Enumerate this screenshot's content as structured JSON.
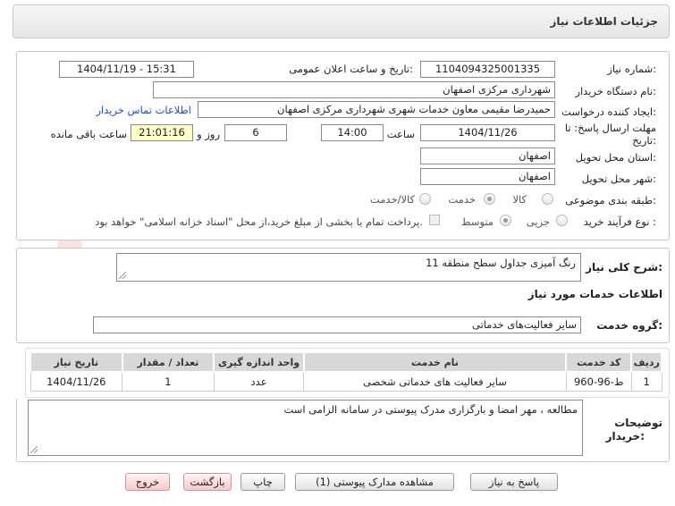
{
  "header": {
    "title": "جزئیات اطلاعات نیاز"
  },
  "form": {
    "need_number_label": "شماره نیاز:",
    "need_number_value": "1104094325001335",
    "announce_label": "تاریخ و ساعت اعلان عمومی:",
    "announce_value": "1404/11/19 - 15:31",
    "buyer_org_label": "نام دستگاه خریدار:",
    "buyer_org_value": "شهرداری مرکزی اصفهان",
    "creator_label": "ایجاد کننده درخواست:",
    "creator_value": "حمیدرضا مقیمی معاون خدمات شهری شهرداری مرکزی اصفهان",
    "contact_link": "اطلاعات تماس خریدار",
    "deadline_label_1": "مهلت ارسال پاسخ: تا",
    "deadline_label_2": "تاریخ:",
    "deadline_date": "1404/11/26",
    "time_label": "ساعت",
    "deadline_time": "14:00",
    "days_value": "6",
    "days_label": "روز و",
    "remaining_time": "21:01:16",
    "remaining_label": "ساعت باقی مانده",
    "province_label": "استان محل تحویل:",
    "province_value": "اصفهان",
    "city_label": "شهر محل تحویل:",
    "city_value": "اصفهان",
    "category_label": "طبقه بندی موضوعی:",
    "category_options": [
      "کالا",
      "خدمت",
      "کالا/خدمت"
    ],
    "category_selected": "خدمت",
    "process_label": "نوع فرآیند خرید :",
    "process_options": [
      "جزیی",
      "متوسط"
    ],
    "process_selected": "متوسط",
    "payment_note": "پرداخت تمام یا بخشی از مبلغ خرید،از محل \"اسناد خزانه اسلامی\" خواهد بود."
  },
  "summary": {
    "label": "شرح کلی نیاز:",
    "value": "رنگ آمیزی جداول سطح منطقه 11"
  },
  "services": {
    "section_title": "اطلاعات خدمات مورد نیاز",
    "group_label": "گروه خدمت:",
    "group_value": "سایر فعالیت‌های خدماتی",
    "columns": [
      "ردیف",
      "کد خدمت",
      "نام خدمت",
      "واحد اندازه گیری",
      "تعداد / مقدار",
      "تاریخ نیاز"
    ],
    "rows": [
      {
        "row": "1",
        "code": "ط-96-960",
        "name": "سایر فعالیت های خدماتی شخصی",
        "unit": "عدد",
        "qty": "1",
        "date": "1404/11/26"
      }
    ]
  },
  "buyer_notes": {
    "label_1": "توضیحات",
    "label_2": "خریدار:",
    "value": "مطالعه ، مهر امضا و بارگزاری مدرک پیوستی در سامانه الزامی است"
  },
  "buttons": {
    "reply": "پاسخ به نیاز",
    "attachments": "مشاهده مدارک پیوستی (1)",
    "print": "چاپ",
    "back": "بازگشت",
    "exit": "خروج"
  },
  "watermark_text": "AriaTender.net",
  "colors": {
    "link": "#1f4fbf",
    "highlight": "#ffffc8",
    "table_header": "#d8d8d8",
    "danger_button": "#f6caca"
  }
}
